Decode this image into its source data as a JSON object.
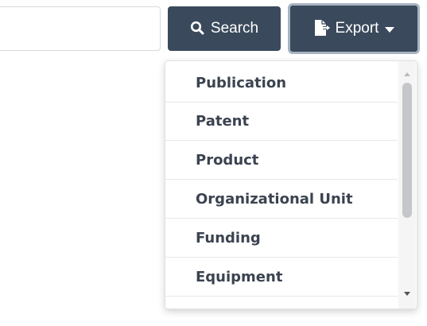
{
  "search": {
    "input_value": "",
    "input_placeholder": "",
    "button_label": "Search",
    "button_icon": "search-icon"
  },
  "export": {
    "button_label": "Export",
    "button_icon": "file-export-icon",
    "caret_icon": "caret-down-icon"
  },
  "dropdown": {
    "items": [
      {
        "label": "Publication"
      },
      {
        "label": "Patent"
      },
      {
        "label": "Product"
      },
      {
        "label": "Organizational Unit"
      },
      {
        "label": "Funding"
      },
      {
        "label": "Equipment"
      }
    ]
  },
  "colors": {
    "button_bg": "#3a4a5c",
    "button_text": "#ffffff",
    "export_focus_ring": "#a8b4c2",
    "item_text": "#3b4350",
    "divider": "#e6e8eb"
  }
}
